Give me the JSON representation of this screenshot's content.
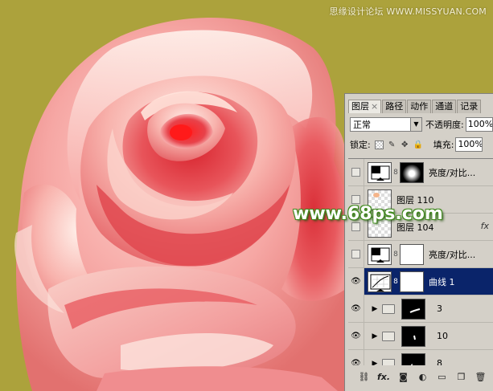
{
  "watermark_top": "思缘设计论坛 WWW.MISSYUAN.COM",
  "watermark_center": "www.68ps.com",
  "panel": {
    "tabs": [
      {
        "label": "图层",
        "active": true,
        "closable": true
      },
      {
        "label": "路径",
        "active": false
      },
      {
        "label": "动作",
        "active": false
      },
      {
        "label": "通道",
        "active": false
      },
      {
        "label": "记录",
        "active": false
      }
    ],
    "blend_mode": "正常",
    "opacity_label": "不透明度:",
    "opacity_value": "100%",
    "lock_label": "锁定:",
    "fill_label": "填充:",
    "fill_value": "100%",
    "layers": [
      {
        "name": "亮度/对比...",
        "type": "adjust",
        "visible": false,
        "selected": false
      },
      {
        "name": "图层 110",
        "type": "pixel",
        "visible": false,
        "selected": false
      },
      {
        "name": "图层 104",
        "type": "pixel",
        "visible": false,
        "selected": false,
        "fx": "fx"
      },
      {
        "name": "亮度/对比...",
        "type": "adjust",
        "visible": false,
        "selected": false
      },
      {
        "name": "曲线 1",
        "type": "curves",
        "visible": true,
        "selected": true
      },
      {
        "name": "3",
        "type": "group",
        "visible": true,
        "selected": false
      },
      {
        "name": "10",
        "type": "group",
        "visible": true,
        "selected": false
      },
      {
        "name": "8",
        "type": "group",
        "visible": true,
        "selected": false
      }
    ]
  },
  "colors": {
    "background": "#aca23c",
    "selection": "#0a246a",
    "panel": "#d4d0c8"
  }
}
